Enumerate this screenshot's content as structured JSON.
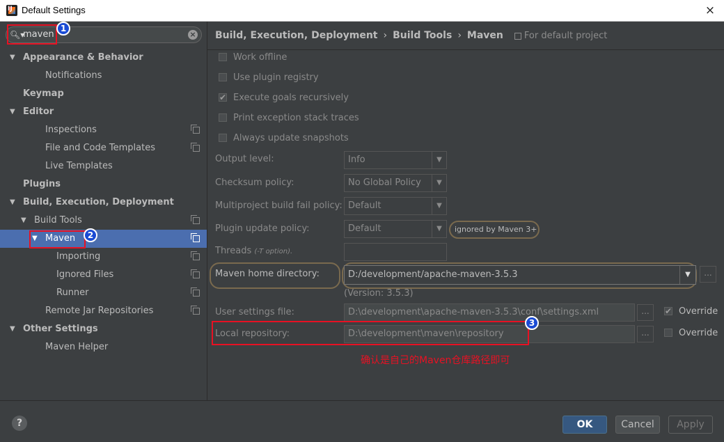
{
  "window": {
    "title": "Default Settings"
  },
  "search": {
    "value": "maven"
  },
  "tree": [
    {
      "label": "Appearance & Behavior",
      "bold": true,
      "arrow": true,
      "indent": 0
    },
    {
      "label": "Notifications",
      "indent": 2
    },
    {
      "label": "Keymap",
      "bold": true,
      "indent": 0
    },
    {
      "label": "Editor",
      "bold": true,
      "arrow": true,
      "indent": 0
    },
    {
      "label": "Inspections",
      "indent": 2,
      "copy": true
    },
    {
      "label": "File and Code Templates",
      "indent": 2,
      "copy": true
    },
    {
      "label": "Live Templates",
      "indent": 2
    },
    {
      "label": "Plugins",
      "bold": true,
      "indent": 0
    },
    {
      "label": "Build, Execution, Deployment",
      "bold": true,
      "arrow": true,
      "indent": 0
    },
    {
      "label": "Build Tools",
      "arrow": true,
      "indent": 1,
      "copy": true
    },
    {
      "label": "Maven",
      "arrow": true,
      "indent": 2,
      "copy": true,
      "selected": true
    },
    {
      "label": "Importing",
      "indent": 3,
      "copy": true
    },
    {
      "label": "Ignored Files",
      "indent": 3,
      "copy": true
    },
    {
      "label": "Runner",
      "indent": 3,
      "copy": true
    },
    {
      "label": "Remote Jar Repositories",
      "indent": 2,
      "copy": true
    },
    {
      "label": "Other Settings",
      "bold": true,
      "arrow": true,
      "indent": 0
    },
    {
      "label": "Maven Helper",
      "indent": 2
    }
  ],
  "breadcrumb": {
    "part1": "Build, Execution, Deployment",
    "part2": "Build Tools",
    "part3": "Maven",
    "scope": "For default project"
  },
  "options": {
    "work_offline": "Work offline",
    "plugin_registry": "Use plugin registry",
    "execute_recursively": "Execute goals recursively",
    "print_stack": "Print exception stack traces",
    "update_snapshots": "Always update snapshots"
  },
  "fields": {
    "output_level": {
      "label": "Output level:",
      "value": "Info"
    },
    "checksum": {
      "label": "Checksum policy:",
      "value": "No Global Policy"
    },
    "multiproject": {
      "label": "Multiproject build fail policy:",
      "value": "Default"
    },
    "plugin_update": {
      "label": "Plugin update policy:",
      "value": "Default",
      "note": "ignored by Maven 3+"
    },
    "threads": {
      "label": "Threads",
      "hint": "(-T option)."
    },
    "maven_home": {
      "label": "Maven home directory:",
      "value": "D:/development/apache-maven-3.5.3",
      "version": "(Version: 3.5.3)"
    },
    "user_settings": {
      "label": "User settings file:",
      "value": "D:\\development\\apache-maven-3.5.3\\conf\\settings.xml",
      "override": "Override"
    },
    "local_repo": {
      "label": "Local repository:",
      "value": "D:\\development\\maven\\repository",
      "override": "Override"
    }
  },
  "annotation": {
    "text": "确认是自己的Maven仓库路径即可",
    "badge1": "1",
    "badge2": "2",
    "badge3": "3"
  },
  "footer": {
    "ok": "OK",
    "cancel": "Cancel",
    "apply": "Apply",
    "help": "?"
  },
  "icons": {
    "close": "×",
    "search": "magnifier-icon",
    "clear": "clear-icon"
  }
}
